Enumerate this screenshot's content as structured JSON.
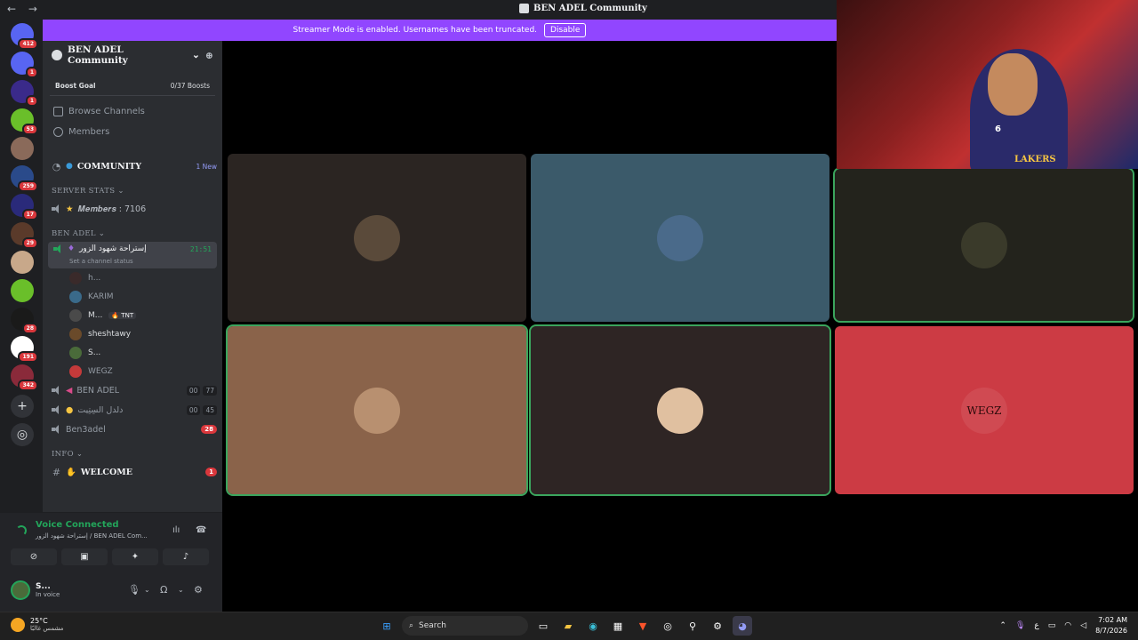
{
  "window": {
    "title": "BEN ADEL Community",
    "back": "←",
    "forward": "→"
  },
  "banner": {
    "text": "Streamer Mode is enabled. Usernames have been truncated.",
    "button": "Disable"
  },
  "guilds": [
    {
      "badge": "412",
      "color": "#5865f2",
      "icon": "discord-home-icon"
    },
    {
      "badge": "1",
      "color": "#5865f2",
      "icon": "discord-icon"
    },
    {
      "badge": "1",
      "color": "#3a2a8a",
      "icon": "ea-fc-icon"
    },
    {
      "badge": "53",
      "color": "#6abf2a",
      "icon": "w-logo-icon"
    },
    {
      "badge": "",
      "color": "#8a6a5a",
      "icon": "server-avatar-icon"
    },
    {
      "badge": "259",
      "color": "#2a4a8a",
      "icon": "server-avatar-icon"
    },
    {
      "badge": "17",
      "color": "#2a2a7a",
      "icon": "ea-icon"
    },
    {
      "badge": "29",
      "color": "#5a3a2a",
      "icon": "server-avatar-icon"
    },
    {
      "badge": "",
      "color": "#c8a88a",
      "icon": "server-avatar-icon"
    },
    {
      "badge": "",
      "color": "#6abf2a",
      "icon": "shrek-icon"
    },
    {
      "badge": "28",
      "color": "#1a1a1a",
      "icon": "tnt-icon"
    },
    {
      "badge": "191",
      "color": "#ffffff",
      "icon": "ben-adel-server-icon"
    },
    {
      "badge": "342",
      "color": "#8a2a3a",
      "icon": "server-avatar-icon"
    }
  ],
  "server": {
    "name": "BEN ADEL Community",
    "boost": {
      "label": "Boost Goal",
      "value": "0/37 Boosts"
    },
    "browse": "Browse Channels",
    "members": "Members",
    "community": {
      "name": "COMMUNITY",
      "tag": "1 New"
    },
    "stats_category": "SERVER STATS",
    "members_count": "𝑴𝒆𝒎𝒃𝒆𝒓𝒔 : 7106",
    "ben_adel_category": "BEN ADEL",
    "active_channel": {
      "name": "إستراحة شهود الزور",
      "time": "21:51",
      "status": "Set a channel status"
    },
    "voice_users": [
      {
        "name": "h...",
        "color": "#3a2a2a",
        "dim": true
      },
      {
        "name": "KARIM",
        "color": "#3a6a8a",
        "dim": true
      },
      {
        "name": "M...",
        "color": "#4a4a4a",
        "dim": false,
        "tag": "🔥 TNT"
      },
      {
        "name": "sheshtawy",
        "color": "#6a4a2a",
        "dim": false
      },
      {
        "name": "S...",
        "color": "#4a6b3a",
        "dim": false
      },
      {
        "name": "WEGZ",
        "color": "#c43a3a",
        "dim": true
      }
    ],
    "channels": [
      {
        "name": "BEN ADEL",
        "a": "00",
        "b": "77"
      },
      {
        "name": "دلدل السِتِيت",
        "a": "00",
        "b": "45"
      },
      {
        "name": "Ben3adel",
        "mention": "28"
      }
    ],
    "info_category": "INFO",
    "welcome": {
      "name": "WELCOME",
      "mention": "1"
    }
  },
  "voice": {
    "title": "Voice Connected",
    "sub": "إستراحة شهود الزور / BEN ADEL Com...",
    "user": {
      "name": "S...",
      "status": "In voice"
    }
  },
  "tiles": [
    {
      "bg": "#2b2522",
      "av": "#5a4a3a",
      "speaking": false
    },
    {
      "bg": "#3b5a6a",
      "av": "#4a6a8a",
      "speaking": false
    },
    {
      "bg": "#23231c",
      "av": "#3a3a2a",
      "speaking": true
    },
    {
      "bg": "#8a634a",
      "av": "#b89070",
      "speaking": true
    },
    {
      "bg": "#2e2524",
      "av": "#e0c0a0",
      "speaking": true
    },
    {
      "bg": "#cc3b44",
      "av": "#d04a52",
      "speaking": false,
      "label": "WEGZ"
    }
  ],
  "webcam": {
    "number": "6",
    "logo": "LAKERS"
  },
  "taskbar": {
    "temp": "25°C",
    "weather": "مشمس غالبًا",
    "search": "Search",
    "lang": "ع",
    "time": "7:02 AM",
    "date": "8/7/2026"
  }
}
